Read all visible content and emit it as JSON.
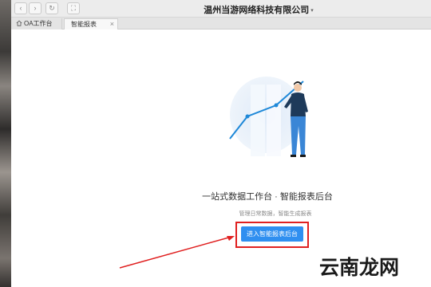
{
  "window": {
    "title": "温州当游网络科技有限公司",
    "title_caret": "▾"
  },
  "toolbar": {
    "back_icon": "chevron-left-icon",
    "forward_icon": "chevron-right-icon",
    "refresh_icon": "refresh-icon",
    "fullscreen_icon": "fullscreen-icon"
  },
  "tabs": [
    {
      "label": "OA工作台",
      "icon": "home-icon",
      "active": false
    },
    {
      "label": "智能报表",
      "active": true,
      "close": "×"
    }
  ],
  "main": {
    "headline": "一站式数据工作台 · 智能报表后台",
    "subline": "管理日常数据，智能生成报表",
    "cta_label": "进入智能报表后台"
  },
  "watermark": "云南龙网",
  "colors": {
    "accent": "#2f8ff0",
    "highlight": "#e02020",
    "illustration_blue": "#1e88d8",
    "figure_navy": "#1e3a5a"
  }
}
